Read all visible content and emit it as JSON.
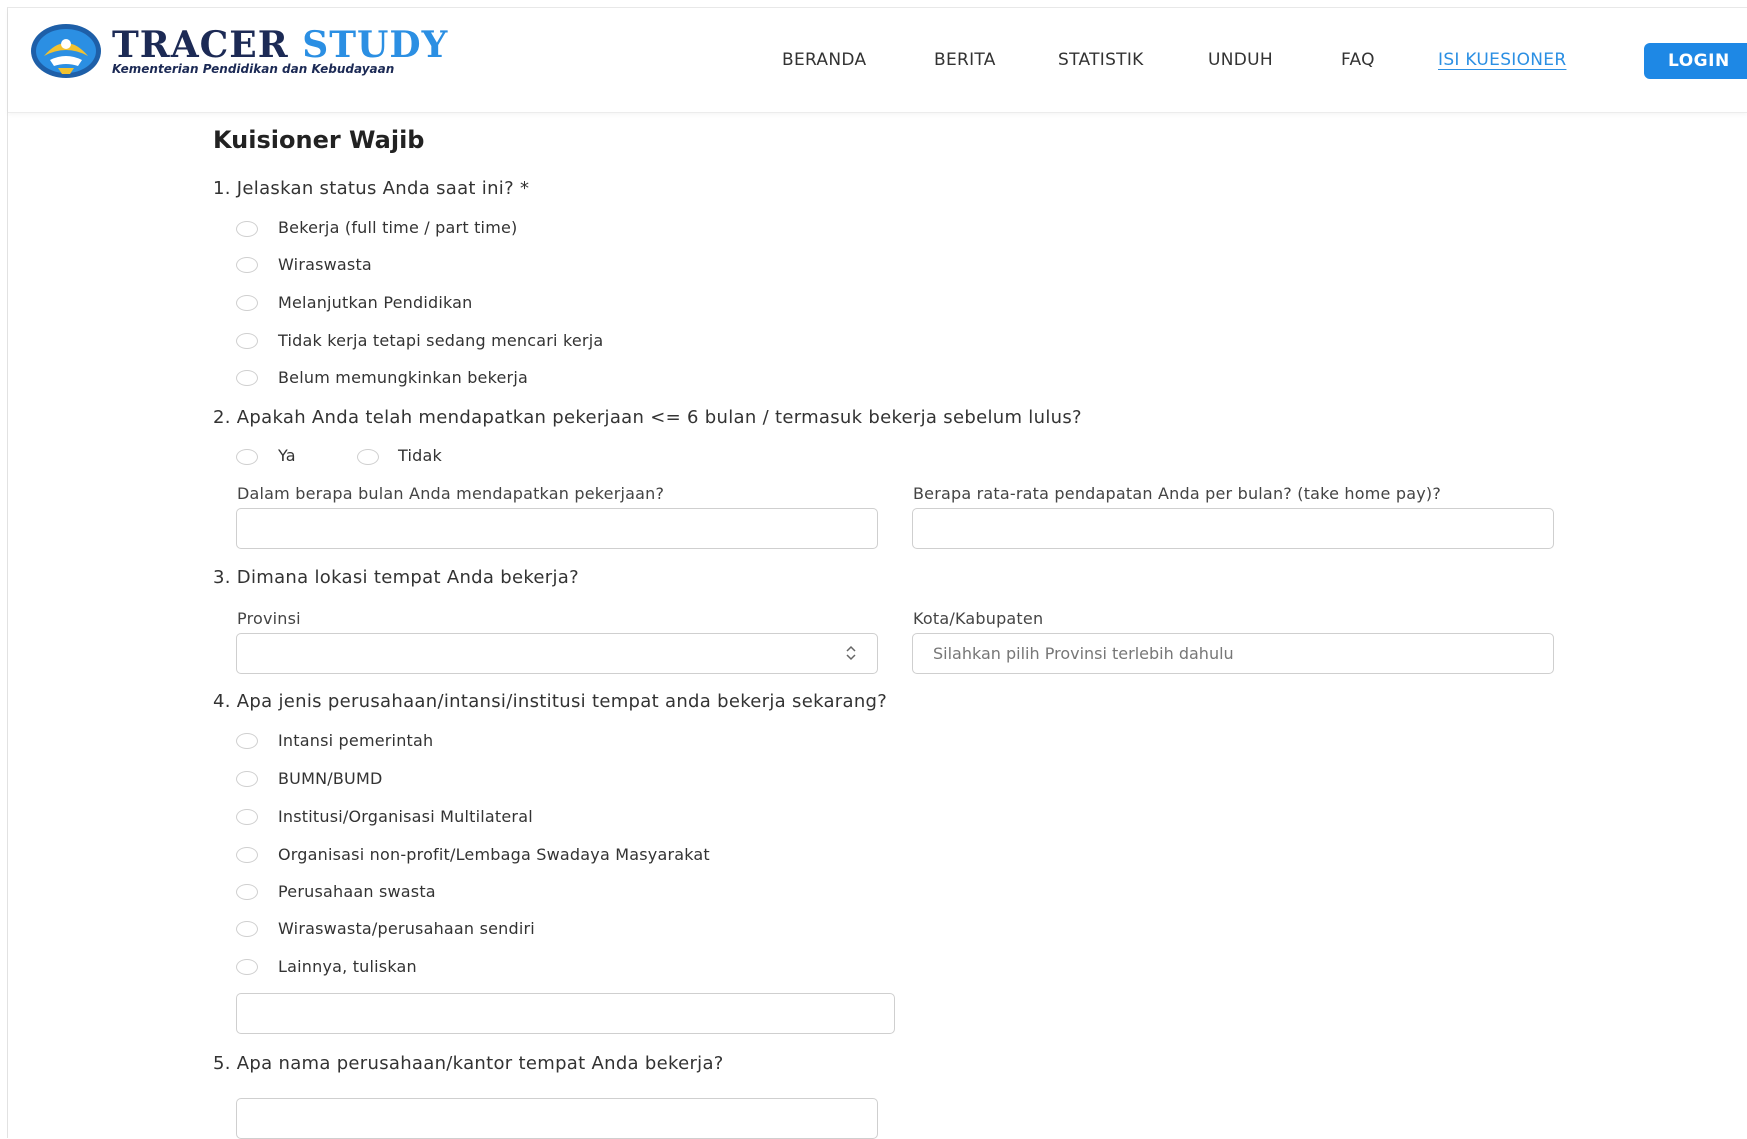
{
  "brand": {
    "title_part1": "TRACER",
    "title_part2": "STUDY",
    "subtitle": "Kementerian Pendidikan dan Kebudayaan"
  },
  "nav": {
    "items": [
      "BERANDA",
      "BERITA",
      "STATISTIK",
      "UNDUH",
      "FAQ",
      "ISI KUESIONER"
    ],
    "active": "ISI KUESIONER",
    "login": "LOGIN"
  },
  "colors": {
    "accent": "#2b8fe3",
    "button": "#1e88e5",
    "brand_dark": "#1c2a55"
  },
  "form": {
    "title": "Kuisioner Wajib",
    "q1": {
      "text": "1. Jelaskan status Anda saat ini? *",
      "options": [
        "Bekerja (full time / part time)",
        "Wiraswasta",
        "Melanjutkan Pendidikan",
        "Tidak kerja tetapi sedang mencari kerja",
        "Belum memungkinkan bekerja"
      ]
    },
    "q2": {
      "text": "2. Apakah Anda telah mendapatkan pekerjaan <= 6 bulan / termasuk bekerja sebelum lulus?",
      "options": [
        "Ya",
        "Tidak"
      ],
      "label_months": "Dalam berapa bulan Anda mendapatkan pekerjaan?",
      "label_income": "Berapa rata-rata pendapatan Anda per bulan? (take home pay)?"
    },
    "q3": {
      "text": "3. Dimana lokasi tempat Anda bekerja?",
      "label_province": "Provinsi",
      "label_city": "Kota/Kabupaten",
      "city_placeholder": "Silahkan pilih Provinsi terlebih dahulu"
    },
    "q4": {
      "text": "4. Apa jenis perusahaan/intansi/institusi tempat anda bekerja sekarang?",
      "options": [
        "Intansi pemerintah",
        "BUMN/BUMD",
        "Institusi/Organisasi Multilateral",
        "Organisasi non-profit/Lembaga Swadaya Masyarakat",
        "Perusahaan swasta",
        "Wiraswasta/perusahaan sendiri",
        "Lainnya, tuliskan"
      ]
    },
    "q5": {
      "text": "5. Apa nama perusahaan/kantor tempat Anda bekerja?"
    }
  }
}
